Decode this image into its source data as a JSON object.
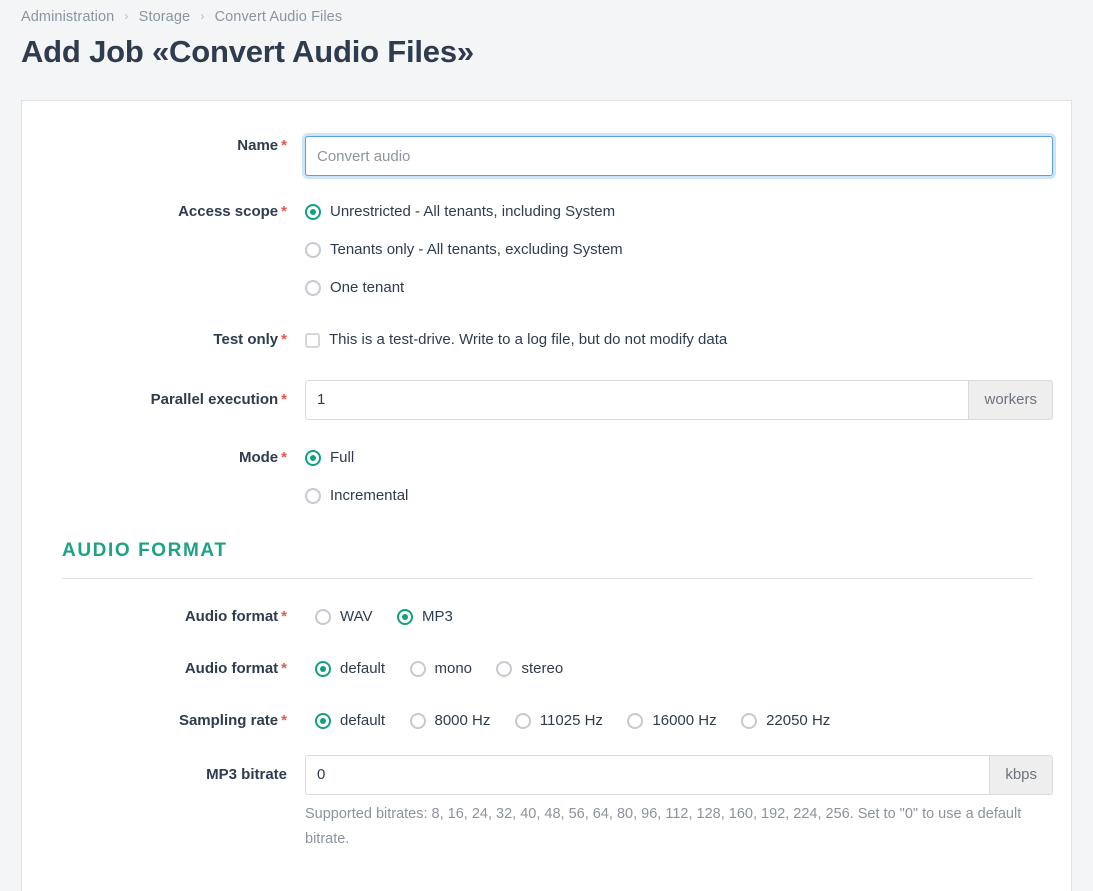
{
  "breadcrumb": {
    "items": [
      "Administration",
      "Storage",
      "Convert Audio Files"
    ],
    "separator": "›"
  },
  "page": {
    "title": "Add Job «Convert Audio Files»"
  },
  "colors": {
    "accent_teal": "#11a080",
    "section_heading": "#1fa185",
    "required_asterisk": "#e8564a",
    "focus_blue": "#5aa0df",
    "page_background": "#f4f5f7",
    "panel_background": "#ffffff",
    "text": "#2f3c4e",
    "muted_text": "#8b939c"
  },
  "form": {
    "required_marker": "*",
    "name": {
      "label": "Name",
      "value": "",
      "placeholder": "Convert audio"
    },
    "access_scope": {
      "label": "Access scope",
      "options": [
        {
          "label": "Unrestricted - All tenants, including System",
          "selected": true
        },
        {
          "label": "Tenants only - All tenants, excluding System",
          "selected": false
        },
        {
          "label": "One tenant",
          "selected": false
        }
      ]
    },
    "test_only": {
      "label": "Test only",
      "checkbox_label": "This is a test-drive. Write to a log file, but do not modify data",
      "checked": false
    },
    "parallel_execution": {
      "label": "Parallel execution",
      "value": "1",
      "addon": "workers"
    },
    "mode": {
      "label": "Mode",
      "options": [
        {
          "label": "Full",
          "selected": true
        },
        {
          "label": "Incremental",
          "selected": false
        }
      ]
    }
  },
  "audio_format_section": {
    "title": "AUDIO FORMAT",
    "container_format": {
      "label": "Audio format",
      "options": [
        {
          "label": "WAV",
          "selected": false
        },
        {
          "label": "MP3",
          "selected": true
        }
      ]
    },
    "channels": {
      "label": "Audio format",
      "options": [
        {
          "label": "default",
          "selected": true
        },
        {
          "label": "mono",
          "selected": false
        },
        {
          "label": "stereo",
          "selected": false
        }
      ]
    },
    "sampling_rate": {
      "label": "Sampling rate",
      "options": [
        {
          "label": "default",
          "selected": true
        },
        {
          "label": "8000 Hz",
          "selected": false
        },
        {
          "label": "11025 Hz",
          "selected": false
        },
        {
          "label": "16000 Hz",
          "selected": false
        },
        {
          "label": "22050 Hz",
          "selected": false
        }
      ]
    },
    "mp3_bitrate": {
      "label": "MP3 bitrate",
      "value": "0",
      "addon": "kbps",
      "help": "Supported bitrates: 8, 16, 24, 32, 40, 48, 56, 64, 80, 96, 112, 128, 160, 192, 224, 256. Set to \"0\" to use a default bitrate."
    }
  }
}
